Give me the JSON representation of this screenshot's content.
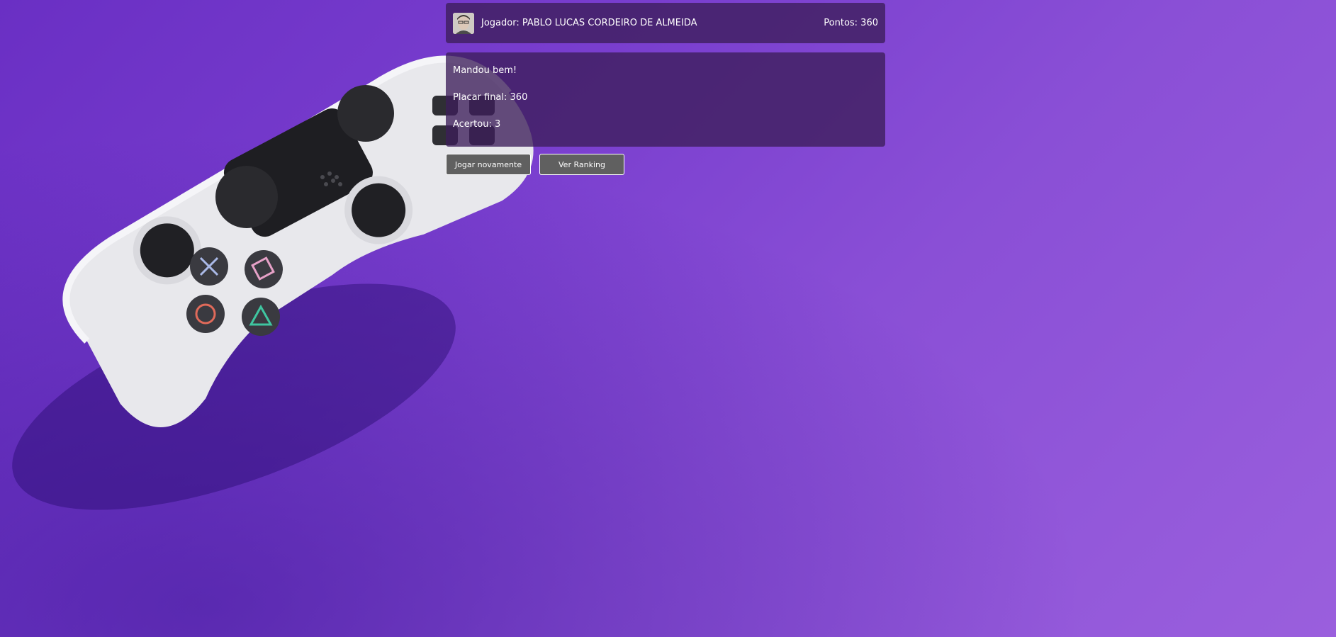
{
  "header": {
    "player_label": "Jogador: PABLO LUCAS CORDEIRO DE ALMEIDA",
    "score_label": "Pontos: 360"
  },
  "result": {
    "message": "Mandou bem!",
    "final_score": "Placar final: 360",
    "hits": "Acertou: 3"
  },
  "actions": {
    "play_again": "Jogar novamente",
    "ranking": "Ver Ranking"
  },
  "colors": {
    "background": "#7a3fcf",
    "panel": "#3c1e5a",
    "button": "#606060"
  }
}
